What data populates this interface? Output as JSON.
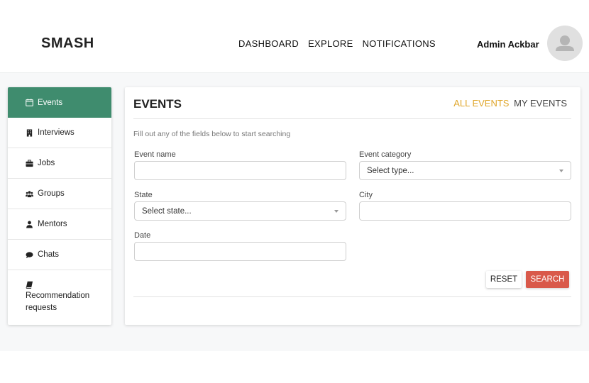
{
  "header": {
    "brand": "SMASH",
    "nav": [
      "DASHBOARD",
      "EXPLORE",
      "NOTIFICATIONS"
    ],
    "user_name": "Admin Ackbar"
  },
  "sidebar": {
    "items": [
      {
        "label": "Events",
        "icon": "calendar-icon"
      },
      {
        "label": "Interviews",
        "icon": "building-icon"
      },
      {
        "label": "Jobs",
        "icon": "briefcase-icon"
      },
      {
        "label": "Groups",
        "icon": "users-icon"
      },
      {
        "label": "Mentors",
        "icon": "user-icon"
      },
      {
        "label": "Chats",
        "icon": "comment-icon"
      },
      {
        "label": "Recommendation requests",
        "icon": "book-icon"
      }
    ],
    "active_index": 0
  },
  "panel": {
    "title": "EVENTS",
    "tab_all": "ALL EVENTS",
    "tab_mine": "MY EVENTS",
    "hint": "Fill out any of the fields below to start searching",
    "fields": {
      "event_name": {
        "label": "Event name",
        "value": ""
      },
      "event_category": {
        "label": "Event category",
        "value": "Select type..."
      },
      "state": {
        "label": "State",
        "value": "Select state..."
      },
      "city": {
        "label": "City",
        "value": ""
      },
      "date": {
        "label": "Date",
        "value": ""
      }
    },
    "reset_label": "RESET",
    "search_label": "SEARCH"
  },
  "colors": {
    "accent_green": "#3f8c6e",
    "accent_orange": "#e0a72c",
    "search_red": "#d9594a"
  }
}
